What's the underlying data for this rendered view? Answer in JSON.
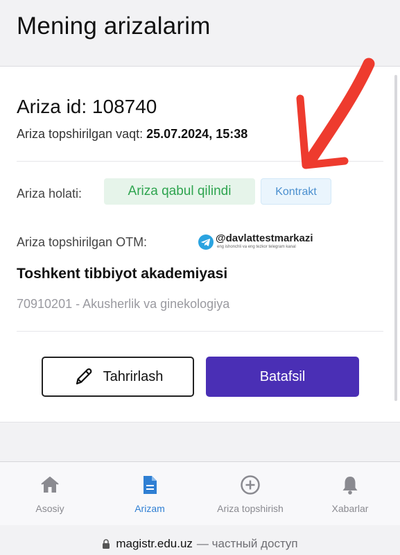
{
  "header": {
    "title": "Mening arizalarim"
  },
  "application": {
    "id_text": "Ariza id: 108740",
    "submitted_label": "Ariza topshirilgan vaqt:",
    "submitted_value": "25.07.2024, 15:38",
    "status_label": "Ariza holati:",
    "status_badge": "Ariza qabul qilindi",
    "type_badge": "Kontrakt",
    "otm_label": "Ariza topshirilgan OTM:",
    "university": "Toshkent tibbiyot akademiyasi",
    "specialty": "70910201 - Akusherlik va ginekologiya"
  },
  "watermark": {
    "handle": "@davlattestmarkazi",
    "subtitle": "eng ishonchli va eng tezkor telegram kanal"
  },
  "actions": {
    "edit_label": "Tahrirlash",
    "details_label": "Batafsil"
  },
  "tabbar": {
    "items": [
      {
        "label": "Asosiy",
        "icon": "home-icon",
        "active": false
      },
      {
        "label": "Arizam",
        "icon": "document-icon",
        "active": true
      },
      {
        "label": "Ariza topshirish",
        "icon": "plus-circle-icon",
        "active": false
      },
      {
        "label": "Xabarlar",
        "icon": "bell-icon",
        "active": false
      }
    ]
  },
  "browser": {
    "domain": "magistr.edu.uz",
    "note": "— частный доступ"
  },
  "colors": {
    "primary": "#4a2fb5",
    "accepted_bg": "#e6f4ea",
    "accepted_text": "#2ea44f",
    "contract_bg": "#eaf5fd",
    "contract_text": "#4a8fcf",
    "active_tab": "#2f7fd3",
    "annotation": "#ee3b2e"
  }
}
